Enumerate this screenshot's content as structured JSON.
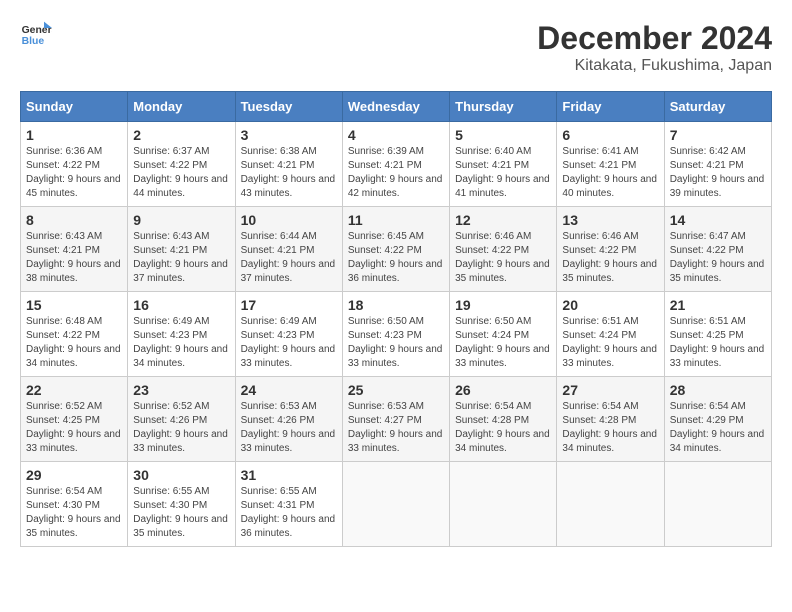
{
  "header": {
    "logo_line1": "General",
    "logo_line2": "Blue",
    "title": "December 2024",
    "subtitle": "Kitakata, Fukushima, Japan"
  },
  "calendar": {
    "days_of_week": [
      "Sunday",
      "Monday",
      "Tuesday",
      "Wednesday",
      "Thursday",
      "Friday",
      "Saturday"
    ],
    "weeks": [
      [
        {
          "day": "1",
          "sunrise": "6:36 AM",
          "sunset": "4:22 PM",
          "daylight": "9 hours and 45 minutes."
        },
        {
          "day": "2",
          "sunrise": "6:37 AM",
          "sunset": "4:22 PM",
          "daylight": "9 hours and 44 minutes."
        },
        {
          "day": "3",
          "sunrise": "6:38 AM",
          "sunset": "4:21 PM",
          "daylight": "9 hours and 43 minutes."
        },
        {
          "day": "4",
          "sunrise": "6:39 AM",
          "sunset": "4:21 PM",
          "daylight": "9 hours and 42 minutes."
        },
        {
          "day": "5",
          "sunrise": "6:40 AM",
          "sunset": "4:21 PM",
          "daylight": "9 hours and 41 minutes."
        },
        {
          "day": "6",
          "sunrise": "6:41 AM",
          "sunset": "4:21 PM",
          "daylight": "9 hours and 40 minutes."
        },
        {
          "day": "7",
          "sunrise": "6:42 AM",
          "sunset": "4:21 PM",
          "daylight": "9 hours and 39 minutes."
        }
      ],
      [
        {
          "day": "8",
          "sunrise": "6:43 AM",
          "sunset": "4:21 PM",
          "daylight": "9 hours and 38 minutes."
        },
        {
          "day": "9",
          "sunrise": "6:43 AM",
          "sunset": "4:21 PM",
          "daylight": "9 hours and 37 minutes."
        },
        {
          "day": "10",
          "sunrise": "6:44 AM",
          "sunset": "4:21 PM",
          "daylight": "9 hours and 37 minutes."
        },
        {
          "day": "11",
          "sunrise": "6:45 AM",
          "sunset": "4:22 PM",
          "daylight": "9 hours and 36 minutes."
        },
        {
          "day": "12",
          "sunrise": "6:46 AM",
          "sunset": "4:22 PM",
          "daylight": "9 hours and 35 minutes."
        },
        {
          "day": "13",
          "sunrise": "6:46 AM",
          "sunset": "4:22 PM",
          "daylight": "9 hours and 35 minutes."
        },
        {
          "day": "14",
          "sunrise": "6:47 AM",
          "sunset": "4:22 PM",
          "daylight": "9 hours and 35 minutes."
        }
      ],
      [
        {
          "day": "15",
          "sunrise": "6:48 AM",
          "sunset": "4:22 PM",
          "daylight": "9 hours and 34 minutes."
        },
        {
          "day": "16",
          "sunrise": "6:49 AM",
          "sunset": "4:23 PM",
          "daylight": "9 hours and 34 minutes."
        },
        {
          "day": "17",
          "sunrise": "6:49 AM",
          "sunset": "4:23 PM",
          "daylight": "9 hours and 33 minutes."
        },
        {
          "day": "18",
          "sunrise": "6:50 AM",
          "sunset": "4:23 PM",
          "daylight": "9 hours and 33 minutes."
        },
        {
          "day": "19",
          "sunrise": "6:50 AM",
          "sunset": "4:24 PM",
          "daylight": "9 hours and 33 minutes."
        },
        {
          "day": "20",
          "sunrise": "6:51 AM",
          "sunset": "4:24 PM",
          "daylight": "9 hours and 33 minutes."
        },
        {
          "day": "21",
          "sunrise": "6:51 AM",
          "sunset": "4:25 PM",
          "daylight": "9 hours and 33 minutes."
        }
      ],
      [
        {
          "day": "22",
          "sunrise": "6:52 AM",
          "sunset": "4:25 PM",
          "daylight": "9 hours and 33 minutes."
        },
        {
          "day": "23",
          "sunrise": "6:52 AM",
          "sunset": "4:26 PM",
          "daylight": "9 hours and 33 minutes."
        },
        {
          "day": "24",
          "sunrise": "6:53 AM",
          "sunset": "4:26 PM",
          "daylight": "9 hours and 33 minutes."
        },
        {
          "day": "25",
          "sunrise": "6:53 AM",
          "sunset": "4:27 PM",
          "daylight": "9 hours and 33 minutes."
        },
        {
          "day": "26",
          "sunrise": "6:54 AM",
          "sunset": "4:28 PM",
          "daylight": "9 hours and 34 minutes."
        },
        {
          "day": "27",
          "sunrise": "6:54 AM",
          "sunset": "4:28 PM",
          "daylight": "9 hours and 34 minutes."
        },
        {
          "day": "28",
          "sunrise": "6:54 AM",
          "sunset": "4:29 PM",
          "daylight": "9 hours and 34 minutes."
        }
      ],
      [
        {
          "day": "29",
          "sunrise": "6:54 AM",
          "sunset": "4:30 PM",
          "daylight": "9 hours and 35 minutes."
        },
        {
          "day": "30",
          "sunrise": "6:55 AM",
          "sunset": "4:30 PM",
          "daylight": "9 hours and 35 minutes."
        },
        {
          "day": "31",
          "sunrise": "6:55 AM",
          "sunset": "4:31 PM",
          "daylight": "9 hours and 36 minutes."
        },
        null,
        null,
        null,
        null
      ]
    ]
  }
}
